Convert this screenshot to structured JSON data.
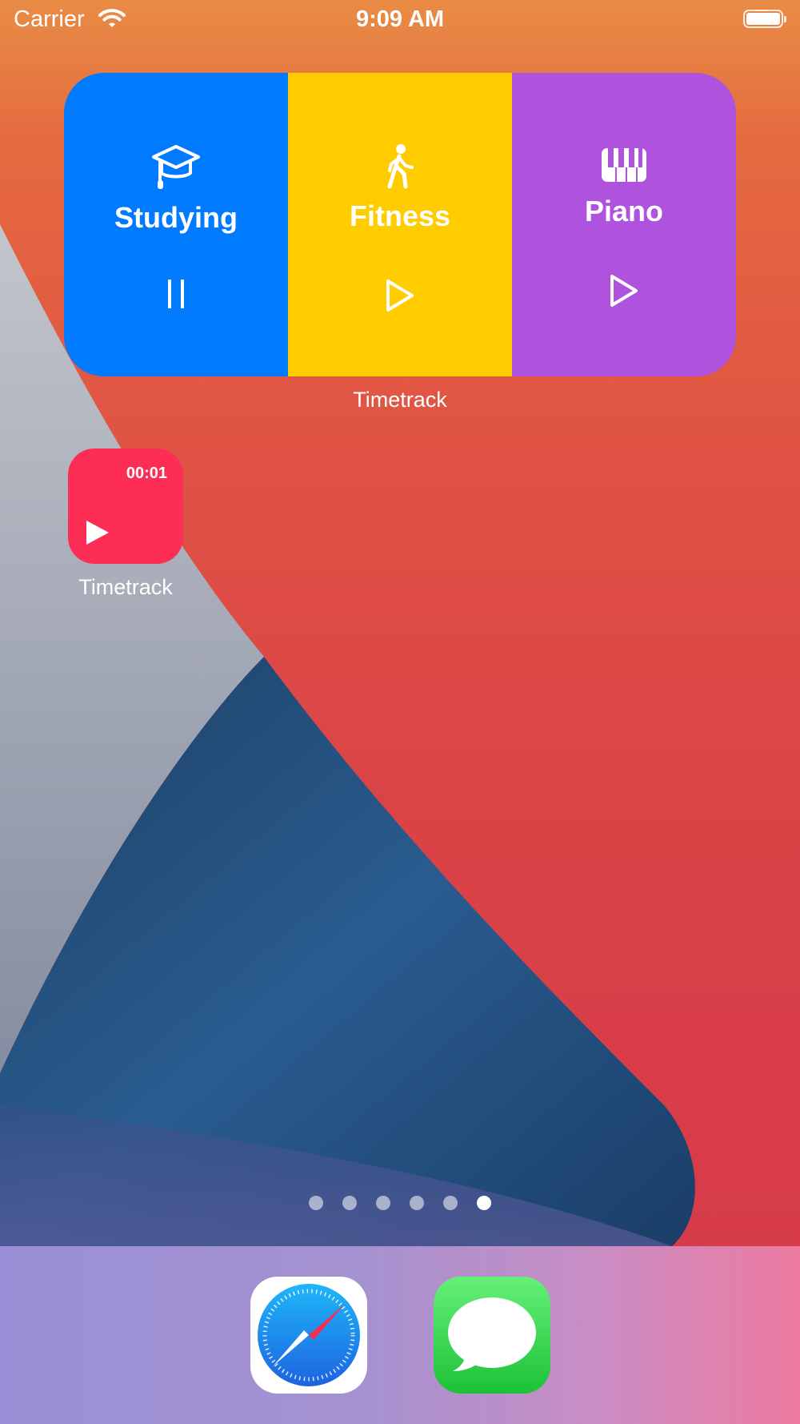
{
  "status_bar": {
    "carrier": "Carrier",
    "time": "9:09 AM"
  },
  "widget": {
    "caption": "Timetrack",
    "items": [
      {
        "label": "Studying",
        "icon": "graduation-cap-icon",
        "control": "pause",
        "color": "#007aff"
      },
      {
        "label": "Fitness",
        "icon": "figure-walk-icon",
        "control": "play",
        "color": "#ffcc00"
      },
      {
        "label": "Piano",
        "icon": "piano-keys-icon",
        "control": "play",
        "color": "#af52de"
      }
    ]
  },
  "app_icon": {
    "time": "00:01",
    "label": "Timetrack",
    "color": "#fe2d56"
  },
  "page_indicator": {
    "count": 6,
    "active_index": 5
  },
  "dock": {
    "apps": [
      {
        "name": "Safari",
        "icon": "safari-compass-icon"
      },
      {
        "name": "Messages",
        "icon": "speech-bubble-icon"
      }
    ]
  }
}
